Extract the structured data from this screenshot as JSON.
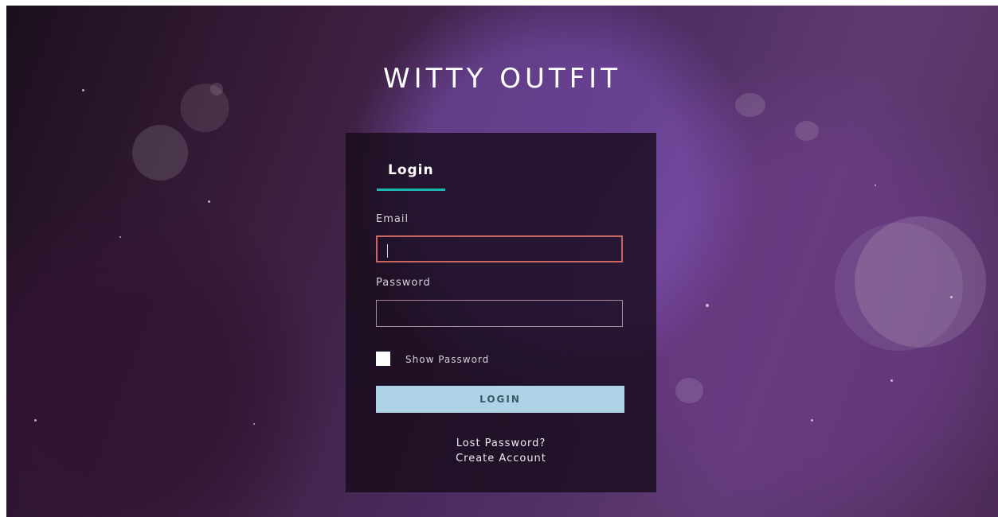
{
  "brand": {
    "title": "WITTY OUTFIT"
  },
  "login": {
    "tab_label": "Login",
    "email_label": "Email",
    "email_value": "",
    "password_label": "Password",
    "password_value": "",
    "show_password_label": "Show Password",
    "show_password_checked": false,
    "submit_label": "LOGIN",
    "lost_password": "Lost Password?",
    "create_account": "Create Account"
  },
  "colors": {
    "tab_underline": "#19b6ad",
    "button_bg": "#aed3e6",
    "active_input_border": "#c8675e"
  }
}
